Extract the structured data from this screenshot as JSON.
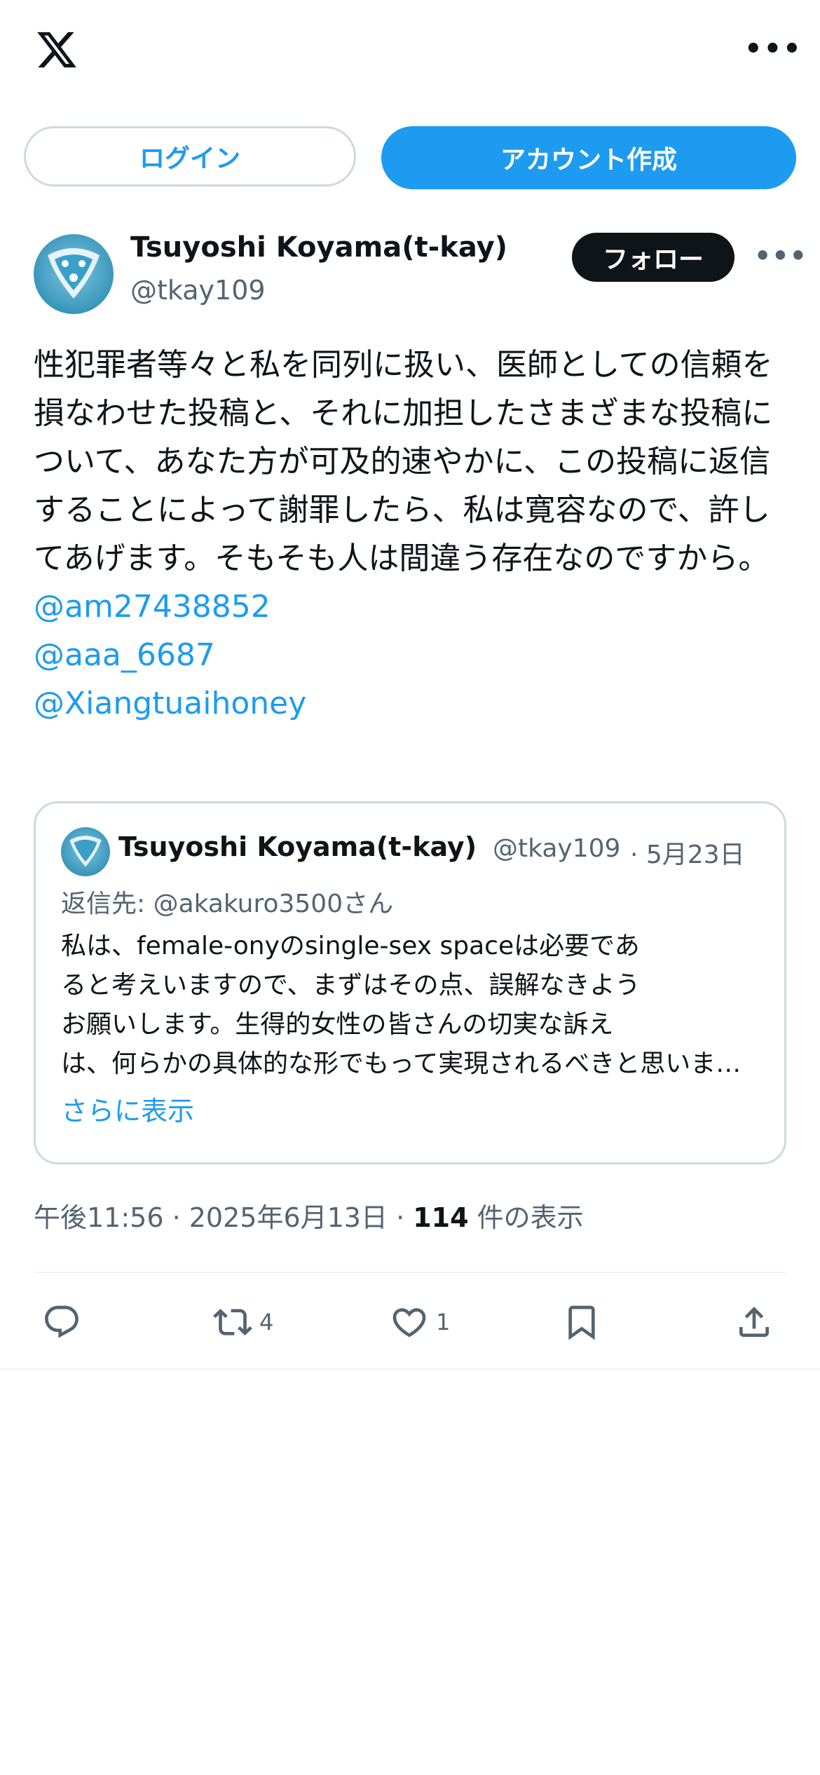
{
  "header": {
    "logo": "x-logo",
    "more_icon": "more-horizontal-icon",
    "more_label": "•••",
    "login_label": "ログイン",
    "signup_label": "アカウント作成"
  },
  "post": {
    "author_name": "Tsuyoshi Koyama(t-kay)",
    "author_handle": "@tkay109",
    "follow_label": "フォロー",
    "more_label": "•••",
    "text": "性犯罪者等々と私を同列に扱い、医師としての信頼を損なわせた投稿と、それに加担したさまざまな投稿について、あなた方が可及的速やかに、この投稿に返信することによって謝罪したら、私は寛容なので、許してあげます。そもそも人は間違う存在なのですから。",
    "mentions": [
      "@am27438852",
      "@aaa_6687",
      "@Xiangtuaihoney"
    ],
    "quote": {
      "author_name": "Tsuyoshi Koyama(t-kay)",
      "author_handle": "@tkay109",
      "date": "· 5月23日",
      "reply_to": "返信先: @akakuro3500さん",
      "text_lines": [
        "私は、female-onyのsingle-sex spaceは必要であ",
        "ると考えいますので、まずはその点、誤解なきよう",
        "お願いします。生得的女性の皆さんの切実な訴え",
        "は、何らかの具体的な形でもって実現されるべきと思います。"
      ],
      "show_more": "さらに表示"
    },
    "time": "午後11:56 · 2025年6月13日 · ",
    "views_count": "114",
    "views_label": " 件の表示",
    "actions": {
      "reply_count": "",
      "repost_count": "4",
      "like_count": "1"
    }
  },
  "colors": {
    "accent": "#1d9bf0",
    "text": "#0f1419",
    "muted": "#536471",
    "border": "#cfd9de"
  }
}
